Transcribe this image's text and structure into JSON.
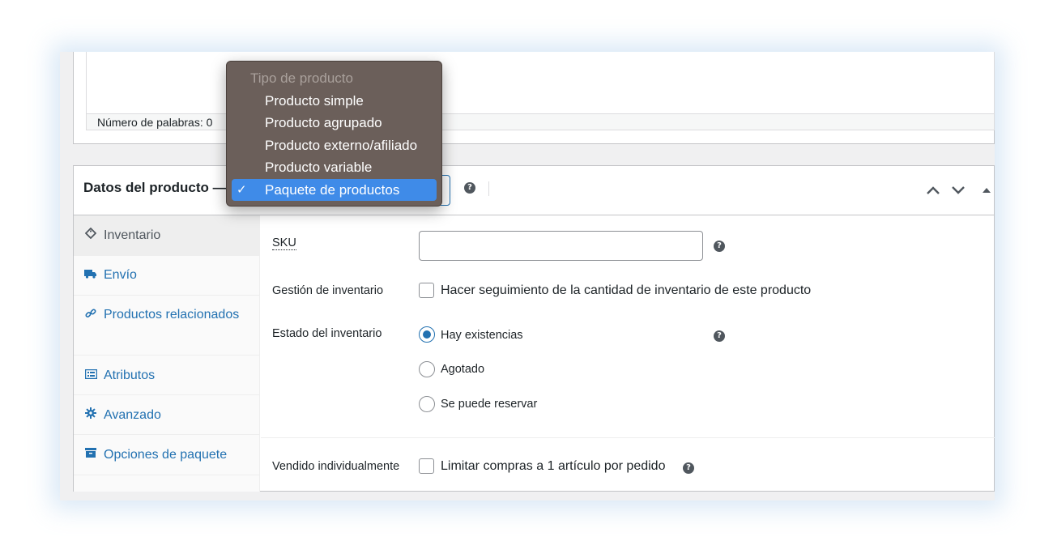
{
  "editor": {
    "word_count": "Número de palabras: 0"
  },
  "product_data": {
    "title": "Datos del producto —",
    "type_dropdown": {
      "group_label": "Tipo de producto",
      "options": [
        "Producto simple",
        "Producto agrupado",
        "Producto externo/afiliado",
        "Producto variable",
        "Paquete de productos"
      ],
      "selected": "Paquete de productos"
    },
    "help_icon": "?"
  },
  "tabs": [
    {
      "label": "Inventario",
      "icon": "tag-icon",
      "active": true
    },
    {
      "label": "Envío",
      "icon": "truck-icon",
      "active": false
    },
    {
      "label": "Productos relacionados",
      "icon": "link-icon",
      "active": false
    },
    {
      "label": "Atributos",
      "icon": "list-icon",
      "active": false
    },
    {
      "label": "Avanzado",
      "icon": "gear-icon",
      "active": false
    },
    {
      "label": "Opciones de paquete",
      "icon": "box-icon",
      "active": false
    }
  ],
  "inventory": {
    "sku_label": "SKU",
    "sku_value": "",
    "manage_stock_label": "Gestión de inventario",
    "manage_stock_text": "Hacer seguimiento de la cantidad de inventario de este producto",
    "stock_status_label": "Estado del inventario",
    "stock_options": [
      {
        "label": "Hay existencias",
        "checked": true
      },
      {
        "label": "Agotado",
        "checked": false
      },
      {
        "label": "Se puede reservar",
        "checked": false
      }
    ],
    "sold_individually_label": "Vendido individualmente",
    "sold_individually_text": "Limitar compras a 1 artículo por pedido"
  },
  "colors": {
    "accent": "#2271b1",
    "dropdown_bg": "#6b5f5a",
    "dropdown_selected": "#3f8be8"
  }
}
